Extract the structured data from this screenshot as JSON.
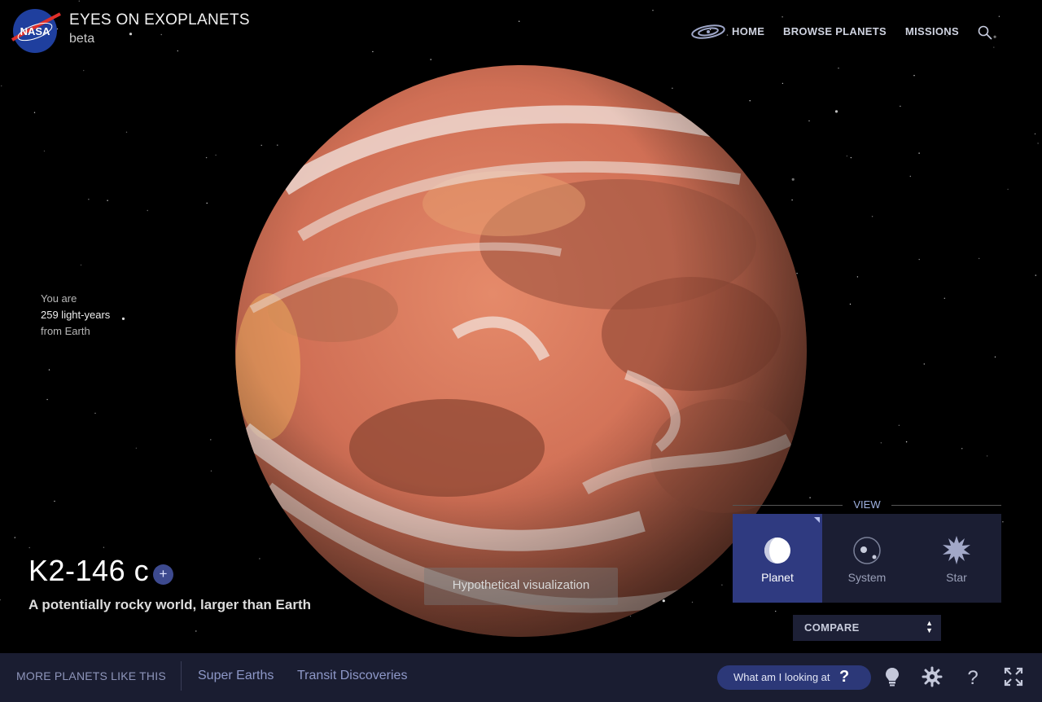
{
  "header": {
    "title": "EYES ON EXOPLANETS",
    "subtitle": "beta",
    "logo_text": "NASA",
    "nav": [
      {
        "label": "HOME",
        "icon": "galaxy-icon"
      },
      {
        "label": "BROWSE PLANETS"
      },
      {
        "label": "MISSIONS"
      }
    ],
    "search_icon": "search-icon"
  },
  "distance": {
    "line1": "You are",
    "line2": "259 light-years",
    "line3": "from Earth"
  },
  "planet": {
    "name": "K2-146 c",
    "tagline": "A potentially rocky world, larger than Earth",
    "add_label": "+",
    "caption": "Hypothetical visualization"
  },
  "view": {
    "label": "VIEW",
    "tabs": [
      {
        "label": "Planet",
        "active": true,
        "icon": "planet-icon"
      },
      {
        "label": "System",
        "active": false,
        "icon": "system-icon"
      },
      {
        "label": "Star",
        "active": false,
        "icon": "star-icon"
      }
    ],
    "compare_label": "COMPARE"
  },
  "bottom": {
    "more_label": "MORE PLANETS LIKE THIS",
    "categories": [
      "Super Earths",
      "Transit Discoveries"
    ],
    "what_label": "What am I looking at",
    "what_q": "?",
    "icons": [
      "lightbulb-icon",
      "settings-icon",
      "help-icon",
      "fullscreen-icon"
    ]
  },
  "colors": {
    "accent": "#2f3a80",
    "panel": "#1b1e33",
    "bottombar": "#1a1d31",
    "planet_base": "#d8765c"
  }
}
